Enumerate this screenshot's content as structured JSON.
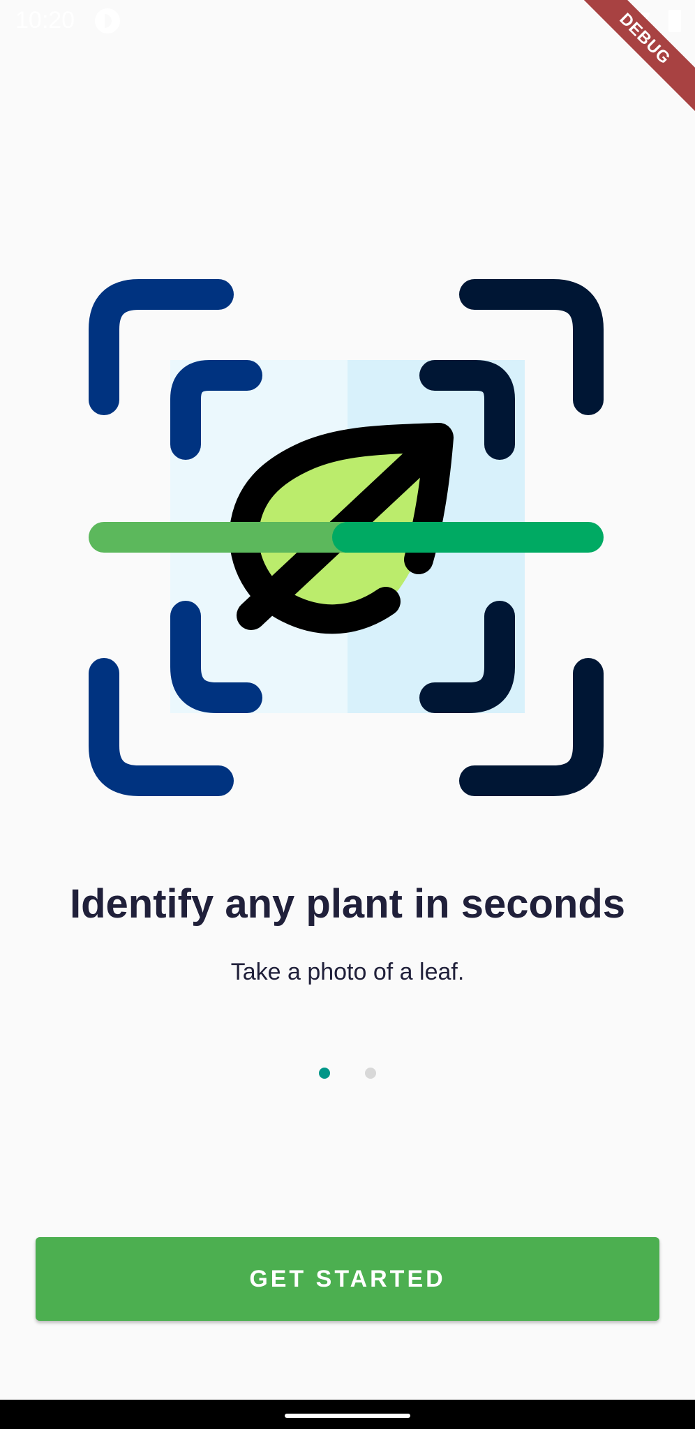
{
  "status_bar": {
    "time": "10:20",
    "icons": [
      "app-status-icon",
      "wifi-icon",
      "battery-icon"
    ]
  },
  "debug_banner": {
    "label": "DEBUG",
    "color": "#a84242"
  },
  "illustration": {
    "icon": "leaf-scan-icon",
    "colors": {
      "frame_left": "#003380",
      "frame_right": "#001634",
      "panel_left": "#ebf8fd",
      "panel_right": "#d8f1fb",
      "leaf_fill": "#bbec6c",
      "scan_line_left": "#5cb85c",
      "scan_line_right": "#00aa63",
      "outline": "#000000"
    }
  },
  "onboarding": {
    "title": "Identify any plant in seconds",
    "subtitle": "Take a photo of a leaf.",
    "page_count": 2,
    "active_page": 1,
    "active_dot_color": "#009688",
    "inactive_dot_color": "#d8d8d8"
  },
  "actions": {
    "get_started_label": "GET STARTED",
    "button_color": "#4caf50"
  }
}
